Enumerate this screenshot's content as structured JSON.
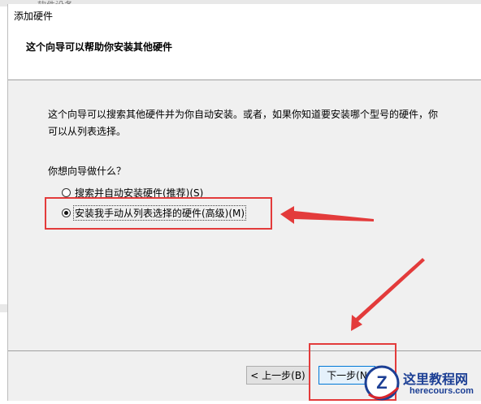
{
  "background": {
    "window_title_partial": "软件设备"
  },
  "dialog": {
    "title": "添加硬件",
    "header": "这个向导可以帮助你安装其他硬件",
    "intro": "这个向导可以搜索其他硬件并为你自动安装。或者，如果你知道要安装哪个型号的硬件，你可以从列表选择。",
    "question": "你想向导做什么？",
    "options": [
      {
        "label": "搜索并自动安装硬件(推荐)(S)",
        "selected": false
      },
      {
        "label": "安装我手动从列表选择的硬件(高级)(M)",
        "selected": true
      }
    ],
    "buttons": {
      "back": "< 上一步(B)",
      "next": "下一步(N"
    }
  },
  "annotations": {
    "highlight_color": "#e33b3b"
  },
  "watermark": {
    "main": "这里教程网",
    "sub": "herecours.com",
    "logo_letter": "Z"
  }
}
